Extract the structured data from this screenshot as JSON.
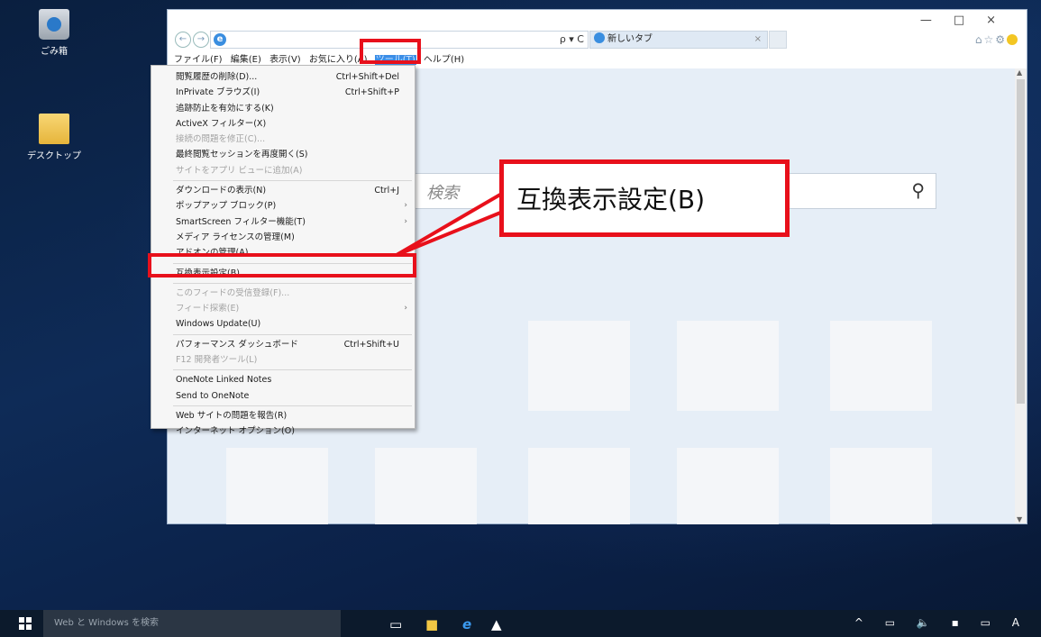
{
  "desktop": {
    "icons": [
      {
        "label": "ごみ箱"
      },
      {
        "label": "デスクトップ"
      }
    ]
  },
  "browser": {
    "nav_back": "←",
    "nav_forward": "→",
    "address_tools": "ρ ▾ C",
    "tab_title": "新しいタブ",
    "tab_close": "×",
    "window_controls": "—□×",
    "toolbar_icons": "⌂☆⚙",
    "menu_bar": [
      "ファイル(F)",
      "編集(E)",
      "表示(V)",
      "お気に入り(A)",
      "ツール(T)",
      "ヘルプ(H)"
    ],
    "active_menu_index": 4,
    "search_placeholder": "検索",
    "search_icon": "⚲",
    "scroll_up": "▲",
    "scroll_down": "▼"
  },
  "tools_menu": {
    "items": [
      {
        "label": "閲覧履歴の削除(D)...",
        "shortcut": "Ctrl+Shift+Del",
        "enabled": true
      },
      {
        "label": "InPrivate ブラウズ(I)",
        "shortcut": "Ctrl+Shift+P",
        "enabled": true
      },
      {
        "label": "追跡防止を有効にする(K)",
        "shortcut": "",
        "enabled": true
      },
      {
        "label": "ActiveX フィルター(X)",
        "shortcut": "",
        "enabled": true
      },
      {
        "label": "接続の問題を修正(C)...",
        "shortcut": "",
        "enabled": false
      },
      {
        "label": "最終閲覧セッションを再度開く(S)",
        "shortcut": "",
        "enabled": true
      },
      {
        "label": "サイトをアプリ ビューに追加(A)",
        "shortcut": "",
        "enabled": false
      },
      {
        "sep": true
      },
      {
        "label": "ダウンロードの表示(N)",
        "shortcut": "Ctrl+J",
        "enabled": true
      },
      {
        "label": "ポップアップ ブロック(P)",
        "shortcut": "",
        "enabled": true,
        "submenu": true
      },
      {
        "label": "SmartScreen フィルター機能(T)",
        "shortcut": "",
        "enabled": true,
        "submenu": true
      },
      {
        "label": "メディア ライセンスの管理(M)",
        "shortcut": "",
        "enabled": true
      },
      {
        "label": "アドオンの管理(A)",
        "shortcut": "",
        "enabled": true
      },
      {
        "sep": true
      },
      {
        "label": "互換表示設定(B)",
        "shortcut": "",
        "enabled": true
      },
      {
        "sep": true
      },
      {
        "label": "このフィードの受信登録(F)...",
        "shortcut": "",
        "enabled": false
      },
      {
        "label": "フィード探索(E)",
        "shortcut": "",
        "enabled": false,
        "submenu": true
      },
      {
        "label": "Windows Update(U)",
        "shortcut": "",
        "enabled": true
      },
      {
        "sep": true
      },
      {
        "label": "パフォーマンス ダッシュボード",
        "shortcut": "Ctrl+Shift+U",
        "enabled": true
      },
      {
        "label": "F12 開発者ツール(L)",
        "shortcut": "",
        "enabled": false
      },
      {
        "sep": true
      },
      {
        "label": "OneNote Linked Notes",
        "shortcut": "",
        "enabled": true
      },
      {
        "label": "Send to OneNote",
        "shortcut": "",
        "enabled": true
      },
      {
        "sep": true
      },
      {
        "label": "Web サイトの問題を報告(R)",
        "shortcut": "",
        "enabled": true
      },
      {
        "label": "インターネット オプション(O)",
        "shortcut": "",
        "enabled": true
      }
    ],
    "submenu_arrow": "›"
  },
  "callout": {
    "text": "互換表示設定(B)",
    "color": "#e8101b"
  },
  "taskbar": {
    "search_placeholder": "Web と Windows を検索",
    "tray_text": "^ ▭ 🔈 ▪ ▭ A"
  }
}
